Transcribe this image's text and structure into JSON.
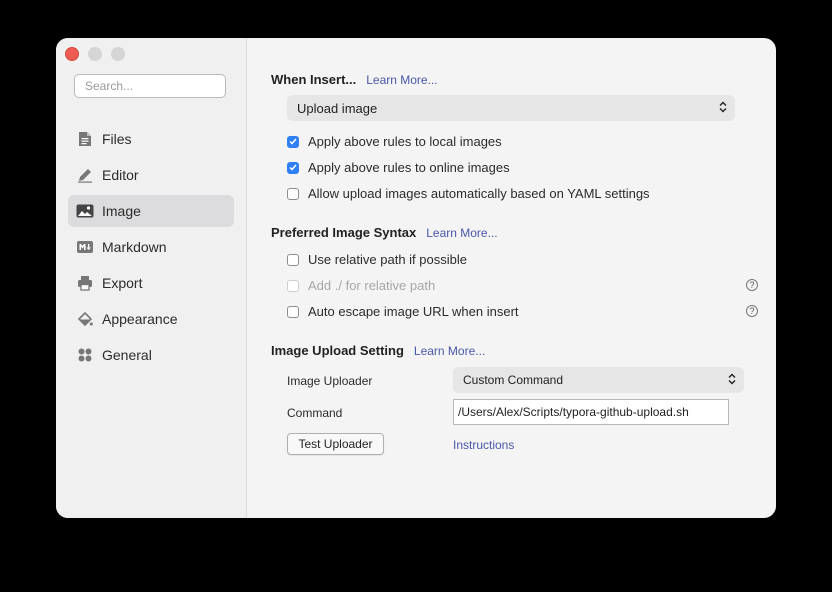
{
  "sidebar": {
    "search_placeholder": "Search...",
    "items": [
      {
        "label": "Files",
        "icon": "file-icon"
      },
      {
        "label": "Editor",
        "icon": "pencil-icon"
      },
      {
        "label": "Image",
        "icon": "image-icon",
        "active": true
      },
      {
        "label": "Markdown",
        "icon": "markdown-icon"
      },
      {
        "label": "Export",
        "icon": "printer-icon"
      },
      {
        "label": "Appearance",
        "icon": "paint-bucket-icon"
      },
      {
        "label": "General",
        "icon": "grid-icon"
      }
    ]
  },
  "when_insert": {
    "title": "When Insert...",
    "learn_more": "Learn More...",
    "selected": "Upload image",
    "options": [
      {
        "label": "Apply above rules to local images",
        "checked": true,
        "disabled": false
      },
      {
        "label": "Apply above rules to online images",
        "checked": true,
        "disabled": false
      },
      {
        "label": "Allow upload images automatically based on YAML settings",
        "checked": false,
        "disabled": false
      }
    ]
  },
  "syntax": {
    "title": "Preferred Image Syntax",
    "learn_more": "Learn More...",
    "options": [
      {
        "label": "Use relative path if possible",
        "checked": false,
        "disabled": false
      },
      {
        "label": "Add ./ for relative path",
        "checked": false,
        "disabled": true,
        "help": "?"
      },
      {
        "label": "Auto escape image URL when insert",
        "checked": false,
        "disabled": false,
        "help": "?"
      }
    ]
  },
  "upload": {
    "title": "Image Upload Setting",
    "learn_more": "Learn More...",
    "uploader_label": "Image Uploader",
    "uploader_value": "Custom Command",
    "command_label": "Command",
    "command_value": "/Users/Alex/Scripts/typora-github-upload.sh",
    "test_button": "Test Uploader",
    "instructions": "Instructions"
  },
  "colors": {
    "accent": "#2f7ff6",
    "link": "#4a57a8",
    "close": "#ee5b52"
  }
}
